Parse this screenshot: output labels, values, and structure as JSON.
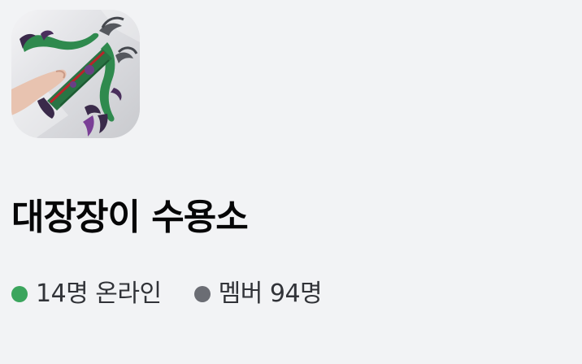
{
  "server": {
    "name": "대장장이 수용소",
    "icon": "server-icon-crossbow",
    "stats": {
      "online": {
        "text": "14명 온라인",
        "dot_color": "#3ba55d"
      },
      "members": {
        "text": "멤버 94명",
        "dot_color": "#6b6d74"
      }
    }
  }
}
